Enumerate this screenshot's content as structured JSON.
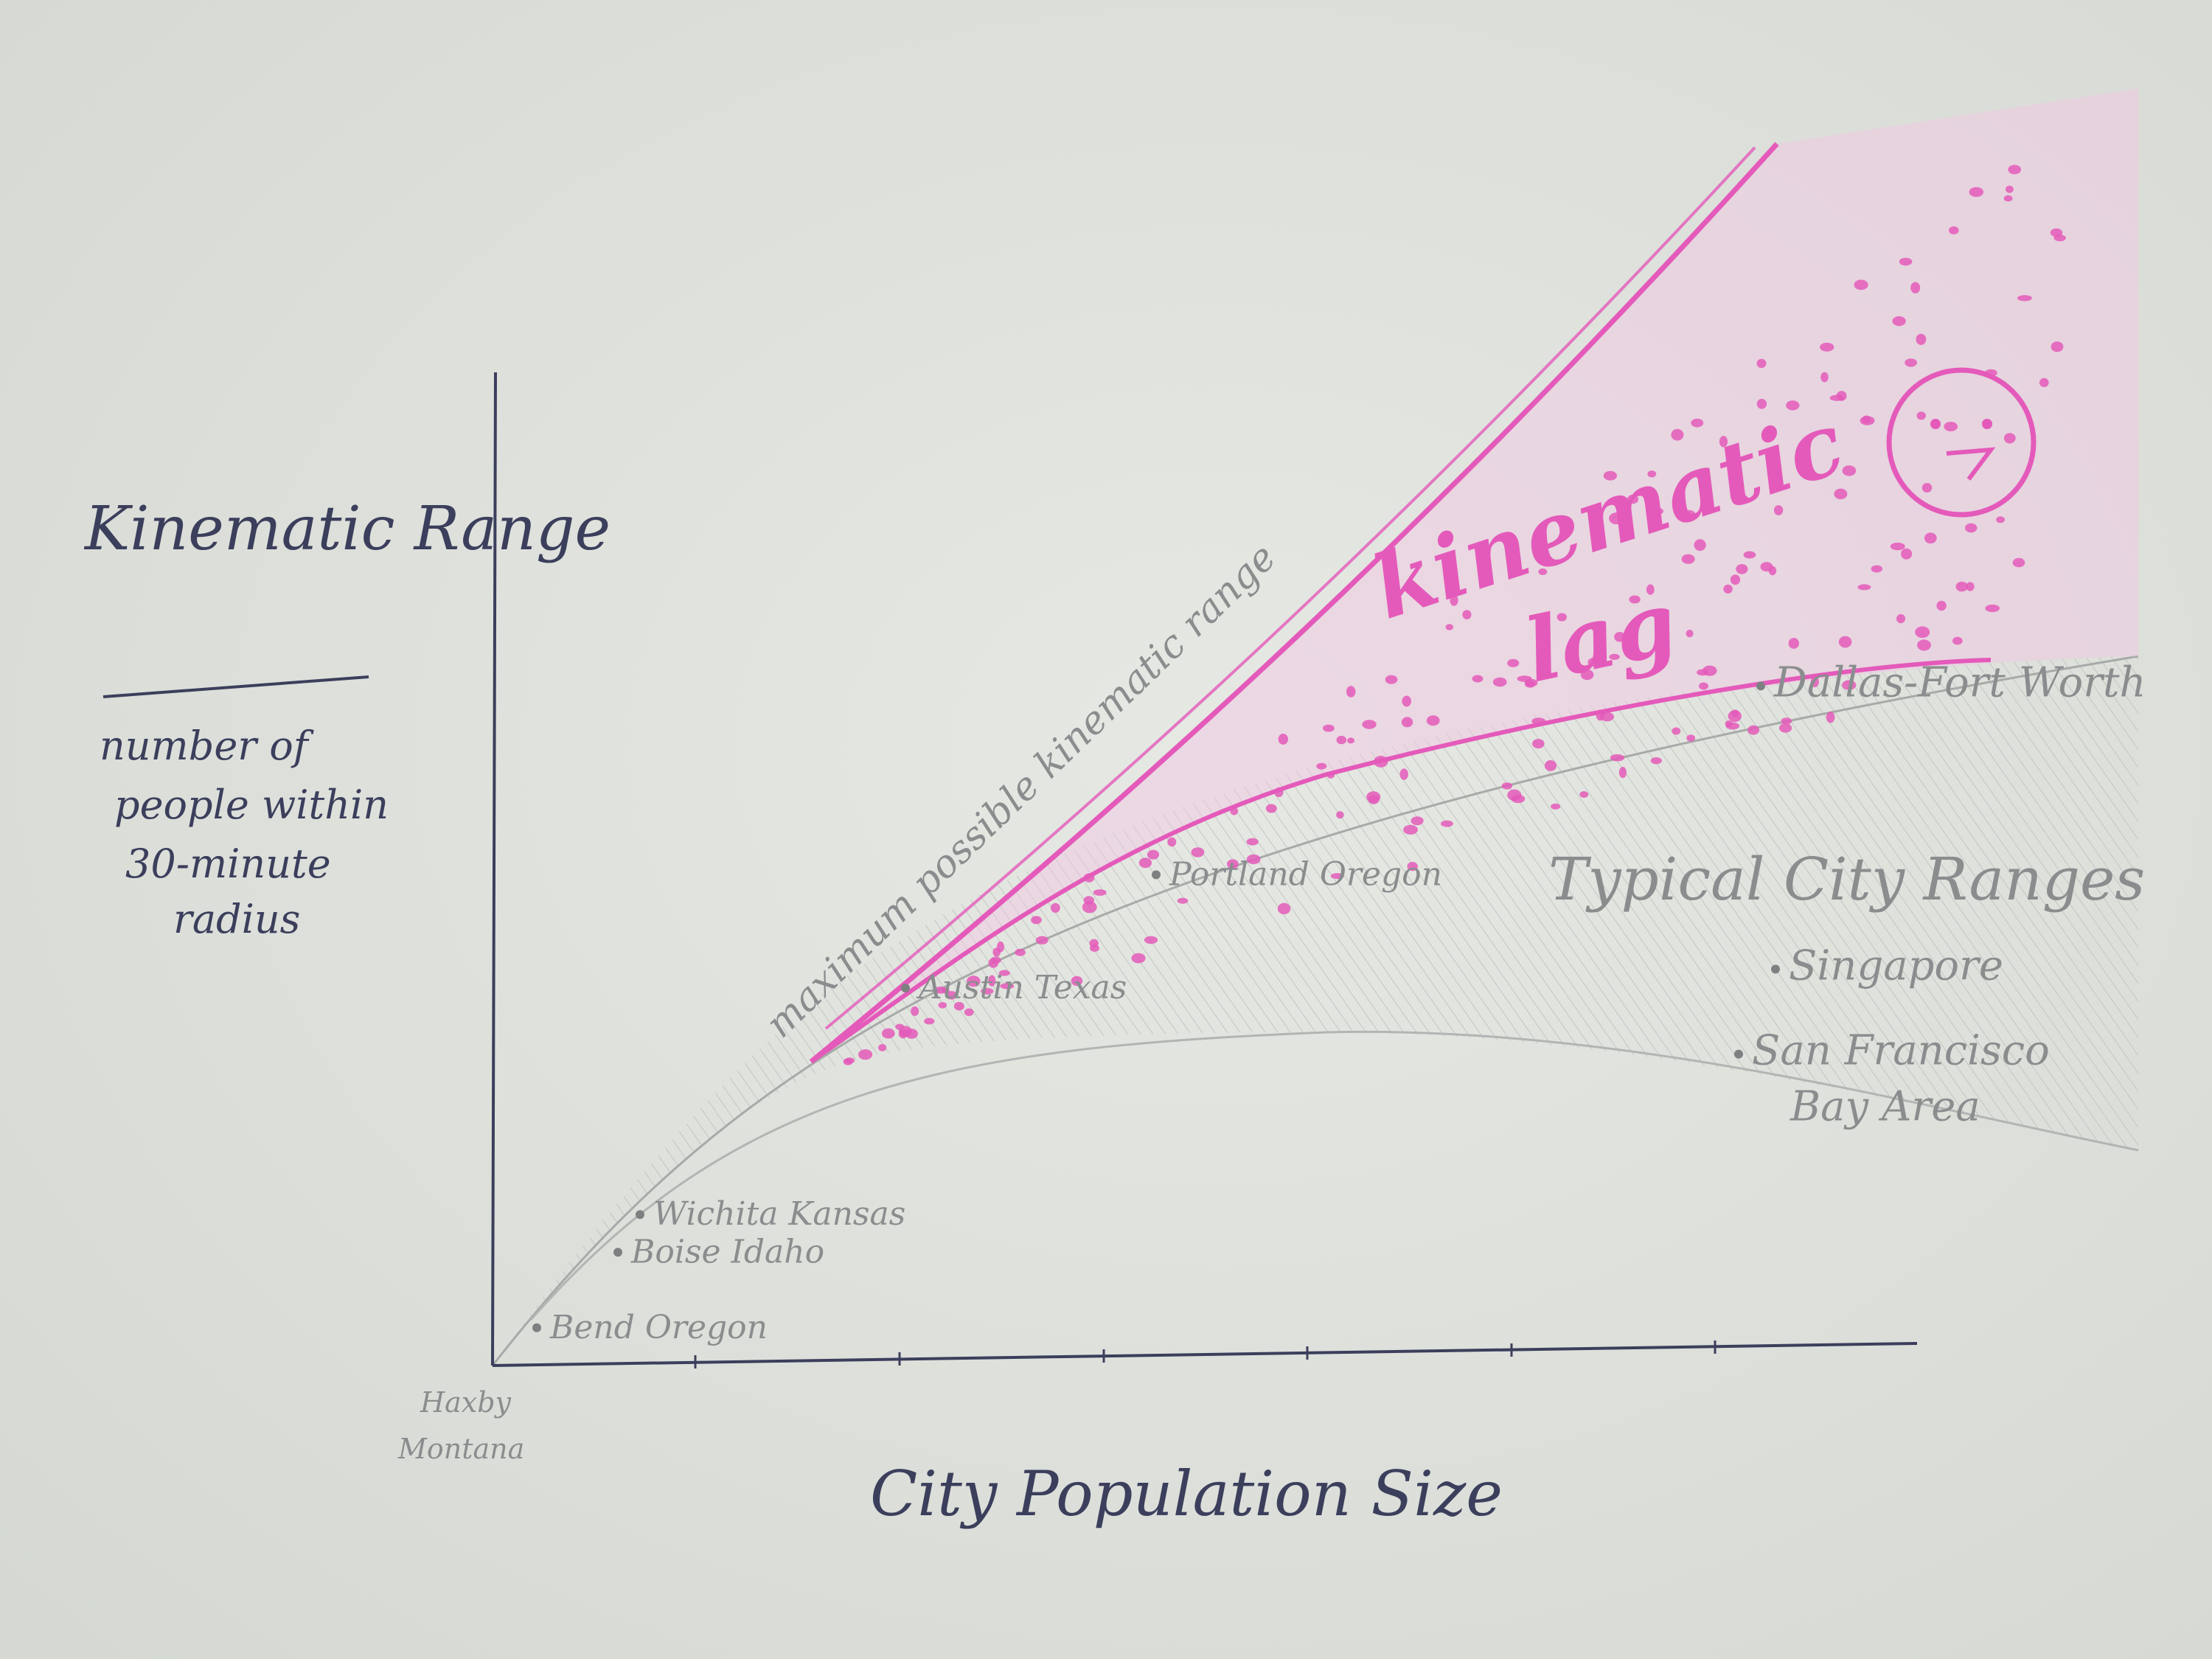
{
  "chart_data": {
    "type": "area",
    "title": "",
    "xlabel": "City Population Size",
    "ylabel": "Kinematic Range",
    "ylabel_sub": [
      "number of",
      "people within",
      "30-minute",
      "radius"
    ],
    "origin_label": [
      "Haxby",
      "Montana"
    ],
    "series": [
      {
        "name": "maximum possible kinematic range",
        "x": [
          0,
          0.15,
          0.3,
          0.45,
          0.6,
          0.75,
          0.9
        ],
        "y": [
          0,
          0.24,
          0.48,
          0.72,
          0.96,
          1.2,
          1.44
        ]
      }
    ],
    "bands": [
      {
        "name": "kinematic lag",
        "color": "#e45aba"
      },
      {
        "name": "Typical City Ranges",
        "color": "#9a9d9c"
      }
    ],
    "points": [
      {
        "label": "Bend Oregon",
        "x": 0.03,
        "y": 0.04
      },
      {
        "label": "Boise Idaho",
        "x": 0.085,
        "y": 0.12
      },
      {
        "label": "Wichita Kansas",
        "x": 0.1,
        "y": 0.16
      },
      {
        "label": "Austin Texas",
        "x": 0.28,
        "y": 0.4
      },
      {
        "label": "Portland Oregon",
        "x": 0.45,
        "y": 0.52
      },
      {
        "label": "Dallas-Fort Worth",
        "x": 0.86,
        "y": 0.72
      },
      {
        "label": "Singapore",
        "x": 0.87,
        "y": 0.42
      },
      {
        "label": "San Francisco",
        "label_line2": "Bay Area",
        "x": 0.845,
        "y": 0.33
      }
    ],
    "annotations": [
      {
        "text": "kinematic",
        "text2": "lag",
        "color": "#e45aba"
      },
      {
        "text": "Typical City Ranges",
        "color": "#8a8d8e"
      }
    ],
    "face_icon": "frown-face-icon",
    "grid": false,
    "legend": "none"
  }
}
